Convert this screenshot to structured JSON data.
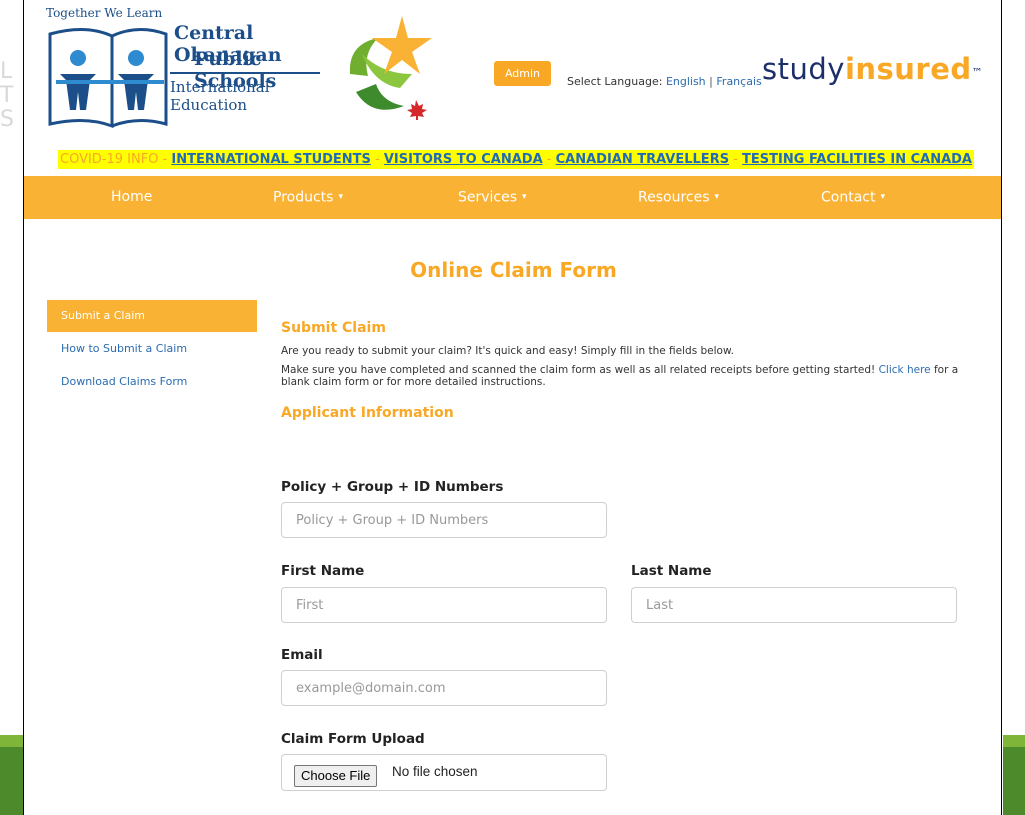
{
  "header": {
    "logo_tagline": "Together We Learn",
    "logo_line1": "Central Okanagan",
    "logo_line2": "Public Schools",
    "logo_line3": "International Education",
    "admin_label": "Admin",
    "language_prefix": "Select Language:",
    "language_english": "English",
    "language_separator": "|",
    "language_french": "Français",
    "brand_part1": "study",
    "brand_part2": "insured",
    "brand_tm": "™"
  },
  "covid_bar": {
    "prefix": "COVID-19 INFO",
    "sep": " - ",
    "links": [
      "INTERNATIONAL STUDENTS",
      "VISITORS TO CANADA",
      "CANADIAN TRAVELLERS",
      "TESTING FACILITIES IN CANADA"
    ]
  },
  "nav": {
    "home": "Home",
    "products": "Products",
    "services": "Services",
    "resources": "Resources",
    "contact": "Contact",
    "caret": "▾"
  },
  "page": {
    "title": "Online Claim Form"
  },
  "sidebar": {
    "items": [
      {
        "label": "Submit a Claim"
      },
      {
        "label": "How to Submit a Claim"
      },
      {
        "label": "Download Claims Form"
      }
    ]
  },
  "content": {
    "heading": "Submit Claim",
    "intro": "Are you ready to submit your claim? It's quick and easy! Simply fill in the fields below.",
    "note_before": "Make sure you have completed and scanned the claim form as well as all related receipts before getting started! ",
    "note_link": "Click here",
    "note_after": " for a blank claim form or for more detailed instructions.",
    "section_heading": "Applicant Information"
  },
  "form": {
    "policy_label": "Policy + Group + ID Numbers",
    "policy_placeholder": "Policy + Group + ID Numbers",
    "first_label": "First Name",
    "first_placeholder": "First",
    "last_label": "Last Name",
    "last_placeholder": "Last",
    "email_label": "Email",
    "email_placeholder": "example@domain.com",
    "upload_label": "Claim Form Upload",
    "upload_button": "Choose File",
    "upload_status": "No file chosen"
  },
  "colors": {
    "accent": "#f9b233",
    "link": "#2b6cb0",
    "brand_navy": "#1c2f6b",
    "highlight": "#ffff00"
  }
}
